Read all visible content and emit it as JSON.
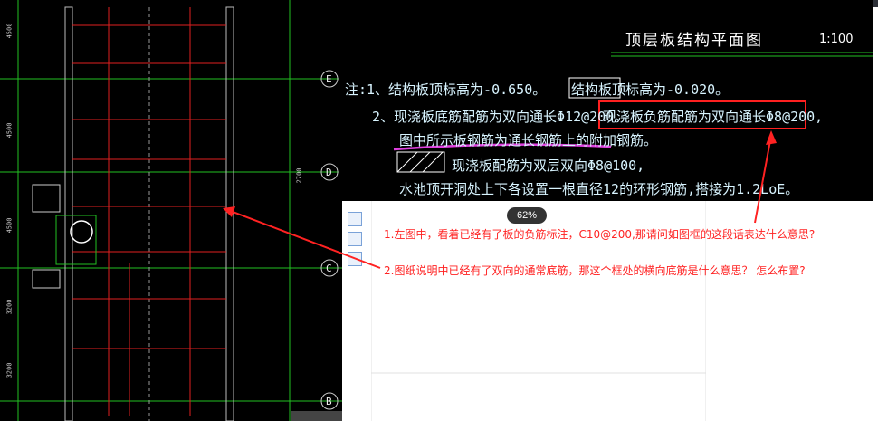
{
  "drawing_title": "顶层板结构平面图",
  "scale": "1:100",
  "notes": {
    "line1": "注:1、结构板顶标高为-0.650。",
    "line1_box": "结构板顶标高为-0.020。",
    "line2": "2、现浇板底筋配筋为双向通长Φ12@200。",
    "line2_box": "现浇板负筋配筋为双向通长Φ8@200,",
    "line3": "图中所示板钢筋为通长钢筋上的附加钢筋。",
    "line4": "现浇板配筋为双层双向Φ8@100,",
    "line5": "水池顶开洞处上下各设置一根直径12的环形钢筋,搭接为1.2LoE。"
  },
  "grid_labels": [
    "E",
    "D",
    "C",
    "B"
  ],
  "dimensions": [
    "4500",
    "4500",
    "4500",
    "3200",
    "3200",
    "2700"
  ],
  "zoom": "62%",
  "questions": {
    "q1": "1.左图中，看着已经有了板的负筋标注，C10@200,那请问如图框的这段话表达什么意思?",
    "q2": "2.图纸说明中已经有了双向的通常底筋，那这个框处的横向底筋是什么意思？ 怎么布置?"
  },
  "colors": {
    "cad_bg": "#000000",
    "annotation_red": "#ff2222",
    "highlight_magenta": "#e040e0",
    "cad_cyan": "#d8f4ff",
    "grid_green": "#22c022"
  }
}
